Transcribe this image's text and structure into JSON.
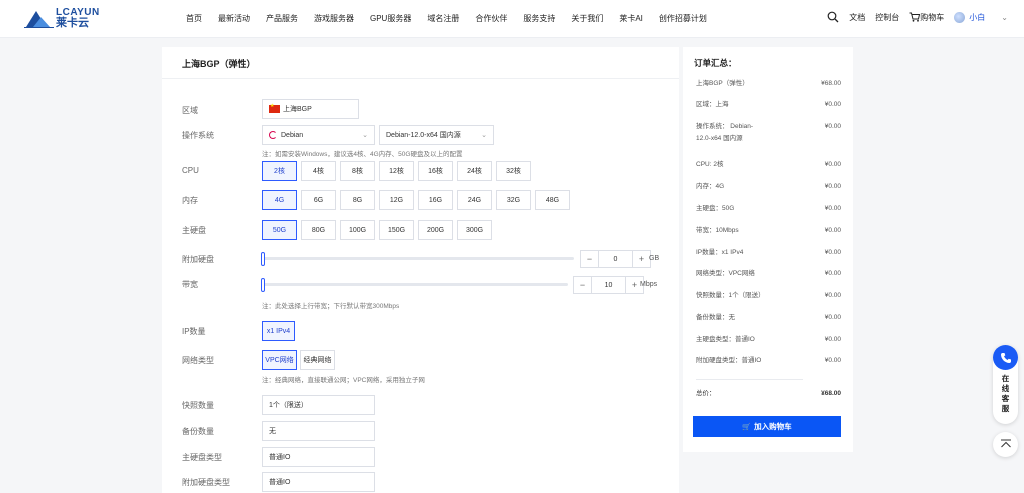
{
  "brand": {
    "logo_en": "LCAYUN",
    "logo_cn": "莱卡云"
  },
  "nav": [
    "首页",
    "最新活动",
    "产品服务",
    "游戏服务器",
    "GPU服务器",
    "域名注册",
    "合作伙伴",
    "服务支持",
    "关于我们",
    "莱卡AI",
    "创作招募计划"
  ],
  "header_right": {
    "docs": "文档",
    "console": "控制台",
    "cart": "购物车",
    "user": "小白"
  },
  "config": {
    "title": "上海BGP（弹性）",
    "region": {
      "label": "区域",
      "value": "上海BGP"
    },
    "os": {
      "label": "操作系统",
      "family": "Debian",
      "version": "Debian-12.0-x64 国内源",
      "note": "注：如需安装Windows，建议选4核、4G内存、50G硬盘及以上的配置"
    },
    "cpu": {
      "label": "CPU",
      "options": [
        "2核",
        "4核",
        "8核",
        "12核",
        "16核",
        "24核",
        "32核"
      ],
      "selected": 0
    },
    "memory": {
      "label": "内存",
      "options": [
        "4G",
        "6G",
        "8G",
        "12G",
        "16G",
        "24G",
        "32G",
        "48G"
      ],
      "selected": 0
    },
    "disk": {
      "label": "主硬盘",
      "options": [
        "50G",
        "80G",
        "100G",
        "150G",
        "200G",
        "300G"
      ],
      "selected": 0
    },
    "extra_disk": {
      "label": "附加硬盘",
      "value": "0",
      "unit": "GB",
      "minus": "−",
      "plus": "+"
    },
    "bandwidth": {
      "label": "带宽",
      "value": "10",
      "unit": "Mbps",
      "minus": "−",
      "plus": "+",
      "note": "注：此处选择上行带宽；下行默认带宽300Mbps"
    },
    "ip": {
      "label": "IP数量",
      "options": [
        "x1 IPv4"
      ],
      "selected": 0
    },
    "network": {
      "label": "网络类型",
      "options": [
        "VPC网络",
        "经典网络"
      ],
      "selected": 0,
      "note": "注：经典网络，直接联通公网；VPC网络，采用独立子网"
    },
    "snapshot": {
      "label": "快照数量",
      "value": "1个（限送）"
    },
    "backup": {
      "label": "备份数量",
      "value": "无"
    },
    "disk_type": {
      "label": "主硬盘类型",
      "value": "普通IO"
    },
    "extra_disk_type": {
      "label": "附加硬盘类型",
      "value": "普通IO"
    }
  },
  "summary": {
    "title": "订单汇总：",
    "rows": [
      {
        "k": "上海BGP（弹性）",
        "v": "¥68.00"
      },
      {
        "k": "区域：上海",
        "v": "¥0.00"
      },
      {
        "k": "操作系统： Debian-12.0-x64 国内源",
        "v": "¥0.00"
      },
      {
        "k": "CPU: 2核",
        "v": "¥0.00"
      },
      {
        "k": "内存：4G",
        "v": "¥0.00"
      },
      {
        "k": "主硬盘：50G",
        "v": "¥0.00"
      },
      {
        "k": "带宽：10Mbps",
        "v": "¥0.00"
      },
      {
        "k": "IP数量：x1 IPv4",
        "v": "¥0.00"
      },
      {
        "k": "网络类型：VPC网络",
        "v": "¥0.00"
      },
      {
        "k": "快照数量：1个（限送）",
        "v": "¥0.00"
      },
      {
        "k": "备份数量：无",
        "v": "¥0.00"
      },
      {
        "k": "主硬盘类型：普通IO",
        "v": "¥0.00"
      },
      {
        "k": "附加硬盘类型：普通IO",
        "v": "¥0.00"
      }
    ],
    "total_label": "总价：",
    "total_value": "¥68.00",
    "add_to_cart": "加入购物车"
  },
  "float": {
    "service": "在线客服"
  },
  "colors": {
    "accent": "#0a56f5",
    "selected_border": "#2e5bff",
    "brand": "#1d4e9e"
  }
}
